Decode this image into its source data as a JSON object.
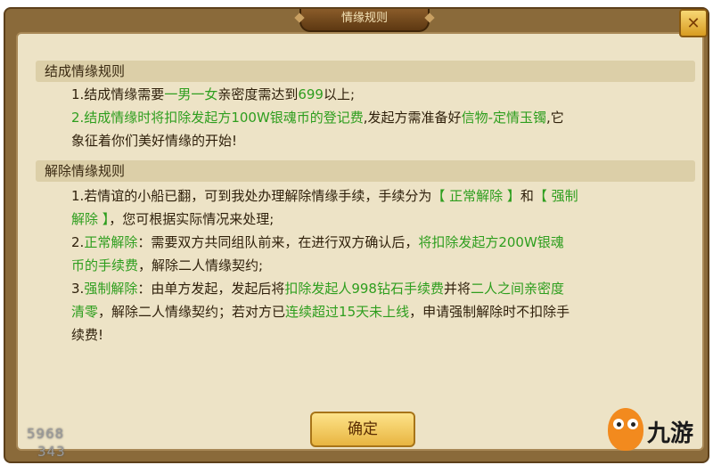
{
  "dialog": {
    "title": "情缘规则",
    "close_glyph": "✕",
    "confirm_label": "确定"
  },
  "section1": {
    "heading": "结成情缘规则",
    "lines": [
      [
        {
          "t": "1.结成情缘需要",
          "g": false
        },
        {
          "t": "一男一女",
          "g": true
        },
        {
          "t": "亲密度需达到",
          "g": false
        },
        {
          "t": "699",
          "g": true
        },
        {
          "t": "以上;",
          "g": false
        }
      ],
      [
        {
          "t": "2.结成情缘时将扣除发起方100W银魂币的登记费",
          "g": true
        },
        {
          "t": ",发起方需准备好",
          "g": false
        },
        {
          "t": "信物-定情玉镯",
          "g": true
        },
        {
          "t": ",它",
          "g": false
        }
      ],
      [
        {
          "t": "象征着你们美好情缘的开始!",
          "g": false
        }
      ]
    ]
  },
  "section2": {
    "heading": "解除情缘规则",
    "lines": [
      [
        {
          "t": "1.若情谊的小船已翻，可到我处办理解除情缘手续，手续分为",
          "g": false
        },
        {
          "t": "【 正常解除 】",
          "g": true
        },
        {
          "t": "和",
          "g": false
        },
        {
          "t": "【 强制",
          "g": true
        }
      ],
      [
        {
          "t": "解除 】",
          "g": true
        },
        {
          "t": "，您可根据实际情况来处理;",
          "g": false
        }
      ],
      [
        {
          "t": "2.",
          "g": false
        },
        {
          "t": "正常解除",
          "g": true
        },
        {
          "t": "：需要双方共同组队前来，在进行双方确认后，",
          "g": false
        },
        {
          "t": "将扣除发起方200W银魂",
          "g": true
        }
      ],
      [
        {
          "t": "币的手续费",
          "g": true
        },
        {
          "t": "，解除二人情缘契约;",
          "g": false
        }
      ],
      [
        {
          "t": "3.",
          "g": false
        },
        {
          "t": "强制解除",
          "g": true
        },
        {
          "t": "：由单方发起，发起后将",
          "g": false
        },
        {
          "t": "扣除发起人998钻石手续费",
          "g": true
        },
        {
          "t": "并将",
          "g": false
        },
        {
          "t": "二人之间亲密度",
          "g": true
        }
      ],
      [
        {
          "t": "清零",
          "g": true
        },
        {
          "t": "，解除二人情缘契约；若对方已",
          "g": false
        },
        {
          "t": "连续超过15天未上线",
          "g": true
        },
        {
          "t": "，申请强制解除时不扣除手",
          "g": false
        }
      ],
      [
        {
          "t": "续费!",
          "g": false
        }
      ]
    ]
  },
  "overlay": {
    "num_top": "5968",
    "num_bottom": "343"
  },
  "watermark": {
    "brand": "九游"
  },
  "colors": {
    "highlight_green": "#2e9e1e",
    "text_dark": "#2e1f0a",
    "panel_bg": "#ede3c6"
  }
}
